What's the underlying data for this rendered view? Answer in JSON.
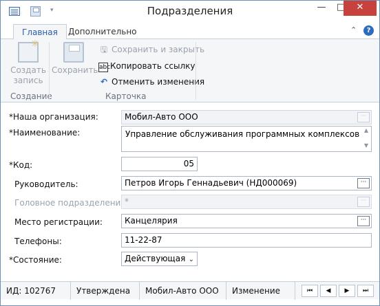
{
  "window": {
    "title": "Подразделения",
    "minimize_label": "—",
    "maximize_label": "□",
    "close_label": "✕",
    "close_color": "#c7423c"
  },
  "ribbon": {
    "tabs": [
      {
        "label": "Главная",
        "active": true
      },
      {
        "label": "Дополнительно",
        "active": false
      }
    ],
    "collapse_label": "⌃",
    "help_label": "?",
    "groups": {
      "create": {
        "label": "Создание",
        "create_button_line1": "Создать",
        "create_button_line2": "запись"
      },
      "card": {
        "label": "Карточка",
        "save_button": "Сохранить",
        "save_close": "Сохранить и закрыть",
        "copy_link": "Копировать ссылку",
        "cancel_changes": "Отменить изменения"
      }
    }
  },
  "form": {
    "our_org": {
      "label": "*Наша организация:",
      "value": "Мобил-Авто ООО"
    },
    "name": {
      "label": "*Наименование:",
      "value": "Управление обслуживания программных комплексов"
    },
    "code": {
      "label": "*Код:",
      "value": "05"
    },
    "head": {
      "label": "Руководитель:",
      "value": "Петров Игорь Геннадьевич (НД000069)"
    },
    "parent": {
      "label": "Головное подразделение:",
      "value": "*"
    },
    "reg_place": {
      "label": "Место регистрации:",
      "value": "Канцелярия"
    },
    "phones": {
      "label": "Телефоны:",
      "value": "11-22-87"
    },
    "state": {
      "label": "*Состояние:",
      "value": "Действующая"
    },
    "picker_label": "···"
  },
  "status": {
    "id": "ИД: 102767",
    "approval": "Утверждена",
    "org": "Мобил-Авто ООО",
    "mode": "Изменение",
    "nav": {
      "first": "⏮",
      "prev": "◀",
      "next": "▶",
      "last": "⏭"
    }
  }
}
